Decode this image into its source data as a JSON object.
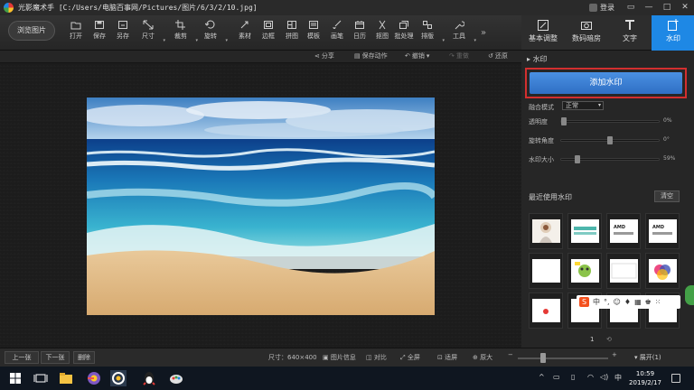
{
  "window": {
    "title": "光影魔术手 [C:/Users/电脑百事网/Pictures/图片/6/3/2/10.jpg]",
    "login_label": "登录",
    "controls": [
      "▭",
      "—",
      "□",
      "✕"
    ]
  },
  "toolbar": {
    "browse_label": "浏览图片",
    "tools": [
      {
        "label": "打开",
        "icon": "open-icon"
      },
      {
        "label": "保存",
        "icon": "save-icon"
      },
      {
        "label": "另存",
        "icon": "save-as-icon"
      },
      {
        "label": "尺寸",
        "icon": "resize-icon"
      },
      {
        "label": "裁剪",
        "icon": "crop-icon"
      },
      {
        "label": "旋转",
        "icon": "rotate-icon"
      },
      {
        "label": "素材",
        "icon": "material-icon"
      },
      {
        "label": "边框",
        "icon": "border-icon"
      },
      {
        "label": "拼图",
        "icon": "collage-icon"
      },
      {
        "label": "模板",
        "icon": "template-icon"
      },
      {
        "label": "画笔",
        "icon": "brush-icon"
      },
      {
        "label": "日历",
        "icon": "calendar-icon"
      },
      {
        "label": "抠图",
        "icon": "cutout-icon"
      },
      {
        "label": "批处理",
        "icon": "batch-icon"
      },
      {
        "label": "排版",
        "icon": "layout-icon"
      },
      {
        "label": "工具",
        "icon": "tools-icon"
      }
    ],
    "more": "»"
  },
  "tabs": [
    {
      "label": "基本调整",
      "icon": "adjust-icon"
    },
    {
      "label": "数码暗房",
      "icon": "darkroom-icon"
    },
    {
      "label": "文字",
      "icon": "text-icon"
    },
    {
      "label": "水印",
      "icon": "watermark-icon"
    }
  ],
  "subbar": {
    "share": "分享",
    "save_action": "保存动作",
    "undo": "撤销",
    "redo": "重做",
    "restore": "还原"
  },
  "panel": {
    "section_title": "水印",
    "add_watermark_label": "添加水印",
    "blend_mode_label": "融合模式",
    "blend_mode_value": "正常",
    "sliders": [
      {
        "label": "透明度",
        "value": "0%",
        "level": 0.0
      },
      {
        "label": "旋转角度",
        "value": "0°",
        "level": 0.5
      },
      {
        "label": "水印大小",
        "value": "59%",
        "level": 0.15
      }
    ],
    "recent_title": "最近使用水印",
    "clear_label": "清空",
    "page": "1",
    "thumb_labels": [
      "",
      "",
      "AMD",
      "AMD",
      "",
      "",
      "",
      "",
      "",
      "",
      "",
      ""
    ]
  },
  "ime": {
    "logo": "S",
    "lang": "中"
  },
  "statusbar": {
    "prev": "上一张",
    "next": "下一张",
    "delete": "删除",
    "size": "尺寸：640×400",
    "info": "图片信息",
    "compare": "对比",
    "fullscreen": "全屏",
    "fit": "适屏",
    "zoom_in": "原大",
    "zoom_level": 0.25,
    "expand": "展开(1)"
  },
  "taskbar": {
    "tray_lang": "中",
    "time": "10:59",
    "date": "2019/2/17"
  }
}
